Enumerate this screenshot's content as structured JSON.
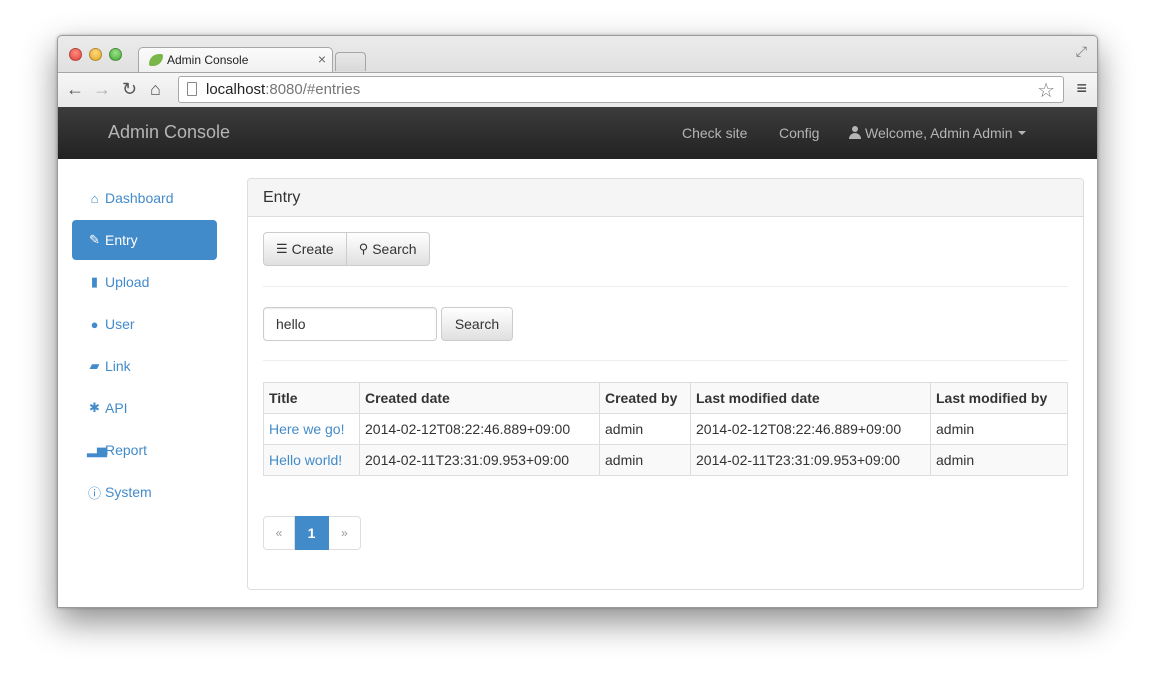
{
  "browser": {
    "tab_title": "Admin Console",
    "tab_close": "×",
    "url_host": "localhost",
    "url_rest": ":8080/#entries"
  },
  "navbar": {
    "brand": "Admin Console",
    "check_site": "Check site",
    "config": "Config",
    "welcome": "Welcome, Admin Admin"
  },
  "sidebar": {
    "items": [
      {
        "label": "Dashboard",
        "icon": "home-icon"
      },
      {
        "label": "Entry",
        "icon": "pencil-icon",
        "active": true
      },
      {
        "label": "Upload",
        "icon": "file-icon"
      },
      {
        "label": "User",
        "icon": "user-icon"
      },
      {
        "label": "Link",
        "icon": "bookmark-icon"
      },
      {
        "label": "API",
        "icon": "asterisk-icon"
      },
      {
        "label": "Report",
        "icon": "stats-icon"
      },
      {
        "label": "System",
        "icon": "info-icon"
      }
    ]
  },
  "panel": {
    "title": "Entry",
    "create_label": "Create",
    "search_toggle_label": "Search",
    "search_value": "hello",
    "search_button": "Search"
  },
  "table": {
    "headers": [
      "Title",
      "Created date",
      "Created by",
      "Last modified date",
      "Last modified by"
    ],
    "rows": [
      [
        "Here we go!",
        "2014-02-12T08:22:46.889+09:00",
        "admin",
        "2014-02-12T08:22:46.889+09:00",
        "admin"
      ],
      [
        "Hello world!",
        "2014-02-11T23:31:09.953+09:00",
        "admin",
        "2014-02-11T23:31:09.953+09:00",
        "admin"
      ]
    ]
  },
  "pagination": {
    "prev": "«",
    "current": "1",
    "next": "»"
  },
  "colors": {
    "primary": "#428bca",
    "navbar": "#222222"
  }
}
